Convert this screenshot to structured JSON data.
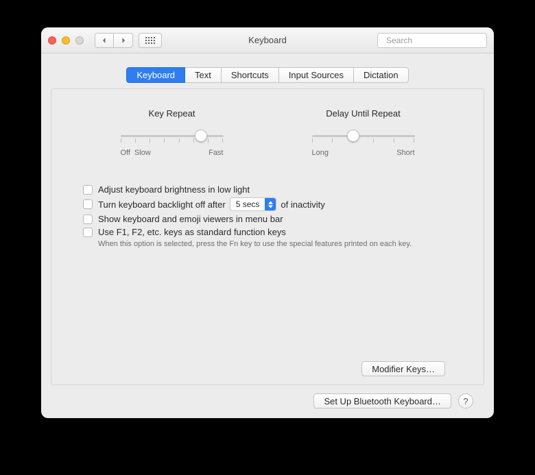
{
  "window": {
    "title": "Keyboard"
  },
  "search": {
    "placeholder": "Search"
  },
  "tabs": [
    {
      "label": "Keyboard"
    },
    {
      "label": "Text"
    },
    {
      "label": "Shortcuts"
    },
    {
      "label": "Input Sources"
    },
    {
      "label": "Dictation"
    }
  ],
  "active_tab_index": 0,
  "sliders": {
    "key_repeat": {
      "title": "Key Repeat",
      "left_label": "Off",
      "mid_label": "Slow",
      "right_label": "Fast",
      "tick_count": 8,
      "value_pct": 78
    },
    "delay": {
      "title": "Delay Until Repeat",
      "left_label": "Long",
      "right_label": "Short",
      "tick_count": 6,
      "value_pct": 40
    }
  },
  "options": {
    "brightness": "Adjust keyboard brightness in low light",
    "backlight_pre": "Turn keyboard backlight off after",
    "backlight_select": "5 secs",
    "backlight_post": "of inactivity",
    "viewers": "Show keyboard and emoji viewers in menu bar",
    "fnkeys": "Use F1, F2, etc. keys as standard function keys",
    "fnkeys_help": "When this option is selected, press the Fn key to use the special features printed on each key."
  },
  "buttons": {
    "modifier_keys": "Modifier Keys…",
    "bluetooth": "Set Up Bluetooth Keyboard…",
    "help": "?"
  }
}
